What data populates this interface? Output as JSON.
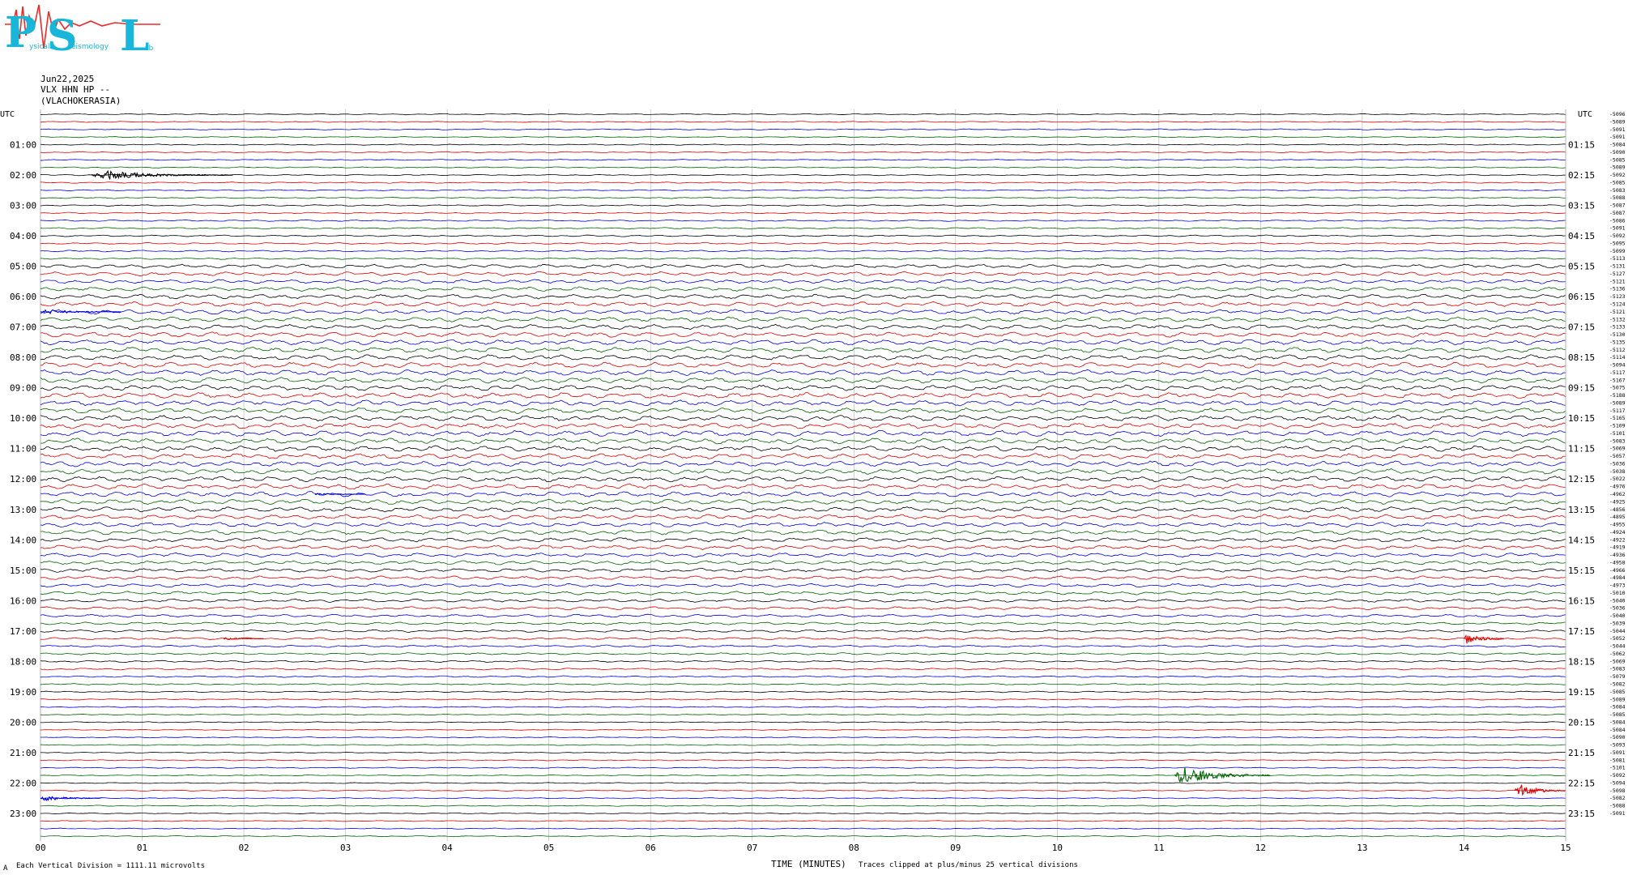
{
  "logo": {
    "letters": [
      "P",
      "S",
      "L"
    ],
    "small_text": [
      "ysical",
      "eismology",
      "ab"
    ],
    "colors": {
      "letters": "#19b6d9",
      "wave": "#e82b2b"
    }
  },
  "header": {
    "date": "Jun22,2025",
    "station": "VLX HHN HP --",
    "location": "(VLACHOKERASIA)"
  },
  "left_axis": {
    "title": "UTC",
    "labels": [
      "01:00",
      "02:00",
      "03:00",
      "04:00",
      "05:00",
      "06:00",
      "07:00",
      "08:00",
      "09:00",
      "10:00",
      "11:00",
      "12:00",
      "13:00",
      "14:00",
      "15:00",
      "16:00",
      "17:00",
      "18:00",
      "19:00",
      "20:00",
      "21:00",
      "22:00",
      "23:00"
    ]
  },
  "right_axis": {
    "title": "UTC",
    "labels": [
      "01:15",
      "02:15",
      "03:15",
      "04:15",
      "05:15",
      "06:15",
      "07:15",
      "08:15",
      "09:15",
      "10:15",
      "11:15",
      "12:15",
      "13:15",
      "14:15",
      "15:15",
      "16:15",
      "17:15",
      "18:15",
      "19:15",
      "20:15",
      "21:15",
      "22:15",
      "23:15"
    ]
  },
  "offsets": [
    "-5096",
    "-5089",
    "-5091",
    "-5091",
    "-5084",
    "-5090",
    "-5085",
    "-5089",
    "-5092",
    "-5085",
    "-5083",
    "-5088",
    "-5087",
    "-5087",
    "-5086",
    "-5091",
    "-5092",
    "-5095",
    "-5099",
    "-5113",
    "-5131",
    "-5127",
    "-5121",
    "-5136",
    "-5123",
    "-5124",
    "-5121",
    "-5132",
    "-5133",
    "-5130",
    "-5135",
    "-5112",
    "-5114",
    "-5094",
    "-5117",
    "-5167",
    "-5075",
    "-5188",
    "-5089",
    "-5117",
    "-5165",
    "-5109",
    "-5101",
    "-5083",
    "-5069",
    "-5057",
    "-5036",
    "-5038",
    "-5022",
    "-4976",
    "-4962",
    "-4925",
    "-4856",
    "-4895",
    "-4955",
    "-4924",
    "-4922",
    "-4919",
    "-4936",
    "-4958",
    "-4966",
    "-4984",
    "-4973",
    "-5010",
    "-5040",
    "-5036",
    "-5040",
    "-5039",
    "-5044",
    "-5052",
    "-5044",
    "-5062",
    "-5069",
    "-5083",
    "-5079",
    "-5082",
    "-5085",
    "-5089",
    "-5084",
    "-5085",
    "-5084",
    "-5084",
    "-5090",
    "-5093",
    "-5091",
    "-5081",
    "-5101",
    "-5092",
    "-5094",
    "-5098",
    "-5082",
    "-5088",
    "-5091"
  ],
  "footer": {
    "x_title": "TIME (MINUTES)",
    "scale_note": "Each Vertical Division = 1111.11 microvolts",
    "clip_note": "Traces clipped at plus/minus 25 vertical divisions",
    "corner_mark": "A"
  },
  "chart_data": {
    "type": "line",
    "title": "",
    "xlabel": "TIME (MINUTES)",
    "ylabel": "UTC",
    "xlim": [
      0,
      15
    ],
    "x_ticks": [
      "00",
      "01",
      "02",
      "03",
      "04",
      "05",
      "06",
      "07",
      "08",
      "09",
      "10",
      "11",
      "12",
      "13",
      "14",
      "15"
    ],
    "grid": true,
    "trace_count": 96,
    "minutes_per_trace": 15,
    "trace_colors": [
      "#000000",
      "#e00000",
      "#0000e0",
      "#006400"
    ],
    "events": [
      {
        "trace": 8,
        "start_min": 0.5,
        "end_min": 1.9,
        "amplitude": 7,
        "color": "#000000"
      },
      {
        "trace": 26,
        "start_min": 0.0,
        "end_min": 0.8,
        "amplitude": 4,
        "color": "#0000e0"
      },
      {
        "trace": 50,
        "start_min": 2.7,
        "end_min": 3.2,
        "amplitude": 2,
        "color": "#0000e0"
      },
      {
        "trace": 69,
        "start_min": 1.8,
        "end_min": 2.2,
        "amplitude": 2,
        "color": "#e00000"
      },
      {
        "trace": 69,
        "start_min": 14.0,
        "end_min": 14.4,
        "amplitude": 10,
        "color": "#e00000"
      },
      {
        "trace": 87,
        "start_min": 11.15,
        "end_min": 12.1,
        "amplitude": 15,
        "color": "#006400"
      },
      {
        "trace": 89,
        "start_min": 14.5,
        "end_min": 15.0,
        "amplitude": 11,
        "color": "#e00000"
      },
      {
        "trace": 90,
        "start_min": 0.0,
        "end_min": 0.6,
        "amplitude": 4,
        "color": "#0000e0"
      }
    ]
  }
}
